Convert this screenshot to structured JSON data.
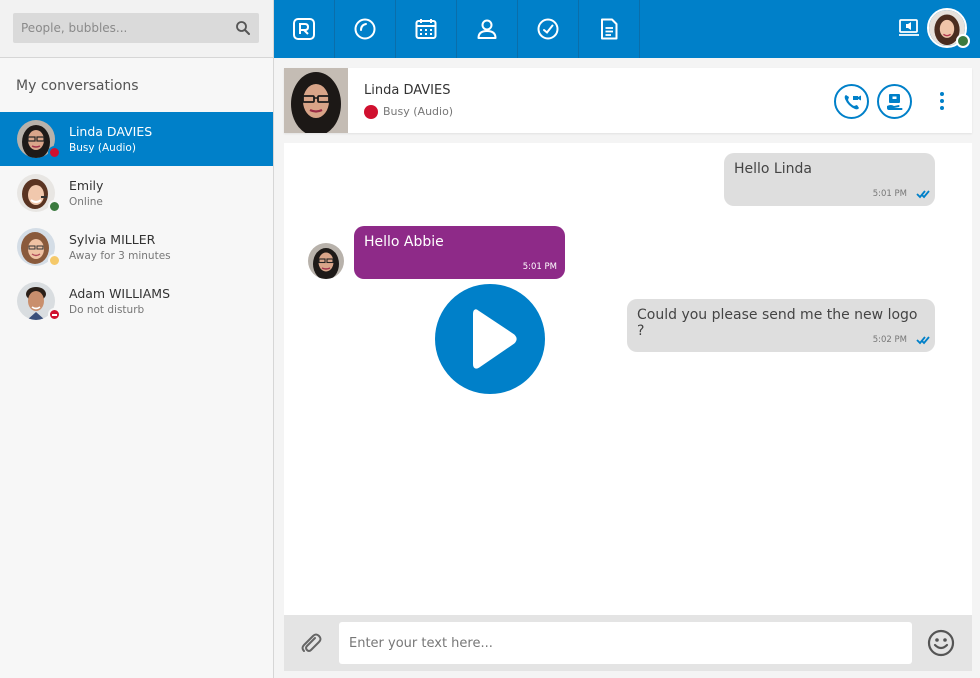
{
  "search": {
    "placeholder": "People, bubbles..."
  },
  "sidebar": {
    "section_title": "My conversations",
    "conversations": [
      {
        "name": "Linda DAVIES",
        "status": "Busy (Audio)",
        "presence_color": "#d0102f",
        "active": true
      },
      {
        "name": "Emily",
        "status": "Online",
        "presence_color": "#3b7a3f",
        "active": false
      },
      {
        "name": "Sylvia MILLER",
        "status": "Away for 3 minutes",
        "presence_color": "#f5c96a",
        "active": false
      },
      {
        "name": "Adam WILLIAMS",
        "status": "Do not disturb",
        "presence_color": "#d0102f",
        "active": false
      }
    ]
  },
  "topbar": {
    "tabs": [
      "rainbow-logo-icon",
      "recent-icon",
      "calendar-icon",
      "contacts-icon",
      "dashboard-icon",
      "notes-icon"
    ],
    "accent": "#0080c9"
  },
  "contact": {
    "name": "Linda DAVIES",
    "status": "Busy (Audio)",
    "status_color": "#d0102f"
  },
  "messages": [
    {
      "direction": "out",
      "text": "Hello Linda",
      "time": "5:01 PM"
    },
    {
      "direction": "in",
      "text": "Hello Abbie",
      "time": "5:01 PM"
    },
    {
      "direction": "out",
      "text": "Could you please send me the new logo ?",
      "time": "5:02 PM"
    }
  ],
  "composer": {
    "placeholder": "Enter your text here..."
  },
  "colors": {
    "brand": "#0080c9",
    "incoming_bubble": "#8e2a88",
    "outgoing_bubble": "#dedede"
  }
}
